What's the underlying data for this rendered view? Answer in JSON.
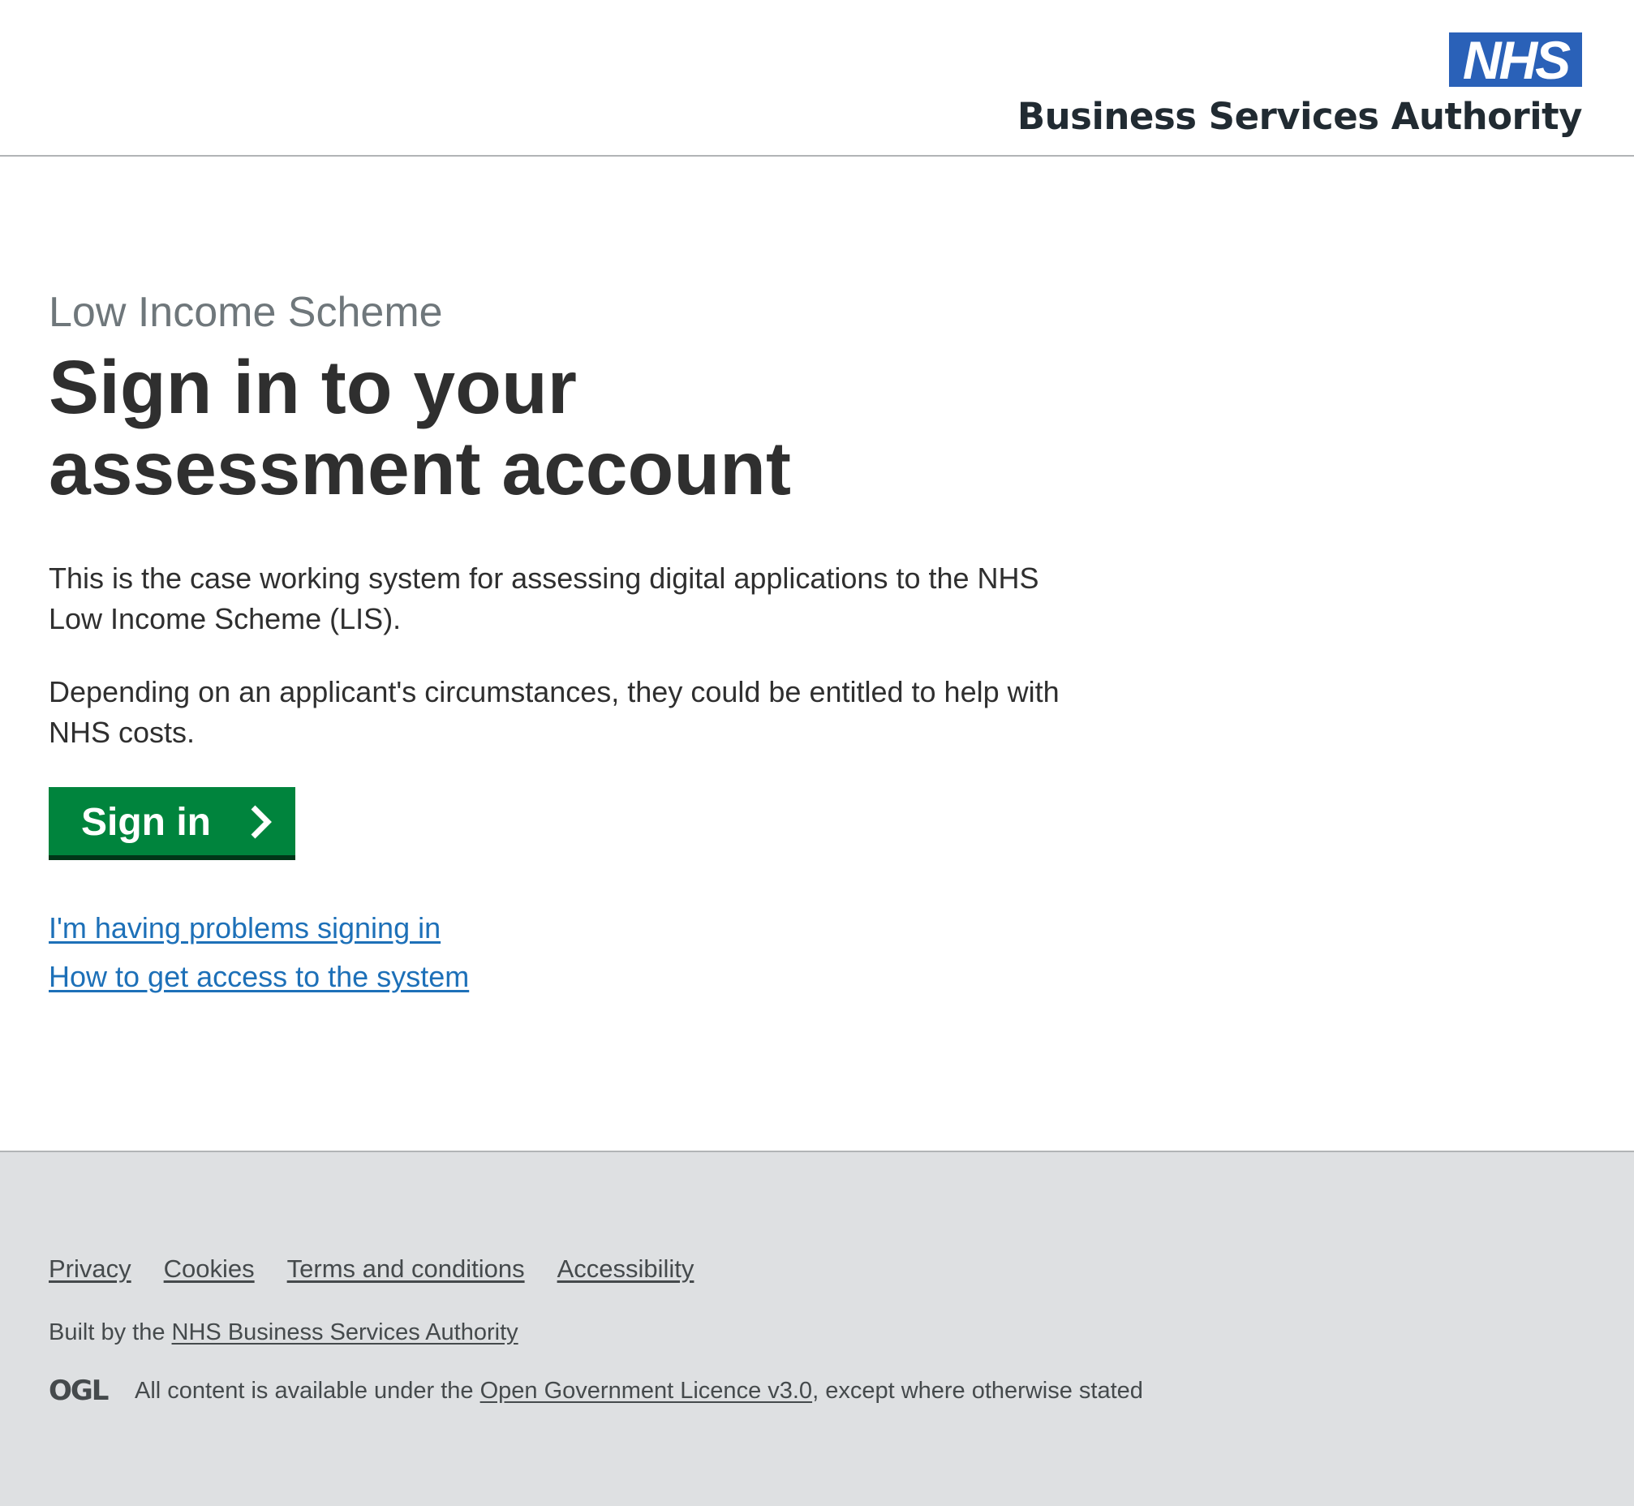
{
  "header": {
    "logo_text": "NHS",
    "org_name": "Business Services Authority"
  },
  "main": {
    "caption": "Low Income Scheme",
    "heading_line1": "Sign in to your",
    "heading_line2": "assessment account",
    "paragraph1": "This is the case working system for assessing digital applications to the NHS Low Income Scheme (LIS).",
    "paragraph2": "Depending on an applicant's circumstances, they could be entitled to help with NHS costs.",
    "signin_button": "Sign in",
    "link_problems": "I'm having problems signing in",
    "link_access": "How to get access to the system"
  },
  "footer": {
    "links": [
      "Privacy",
      "Cookies",
      "Terms and conditions",
      "Accessibility"
    ],
    "built_by_prefix": "Built by the ",
    "built_by_link": "NHS Business Services Authority",
    "ogl_logo_text": "OGL",
    "licence_prefix": "All content is available under the ",
    "licence_link": "Open Government Licence v3.0",
    "licence_suffix": ", except where otherwise stated"
  },
  "colors": {
    "nhs_blue": "#2a61b8",
    "button_green": "#00843d",
    "button_shadow": "#003618",
    "link_blue": "#1d70b8",
    "footer_bg": "#dee0e2",
    "caption_grey": "#6f777b"
  }
}
